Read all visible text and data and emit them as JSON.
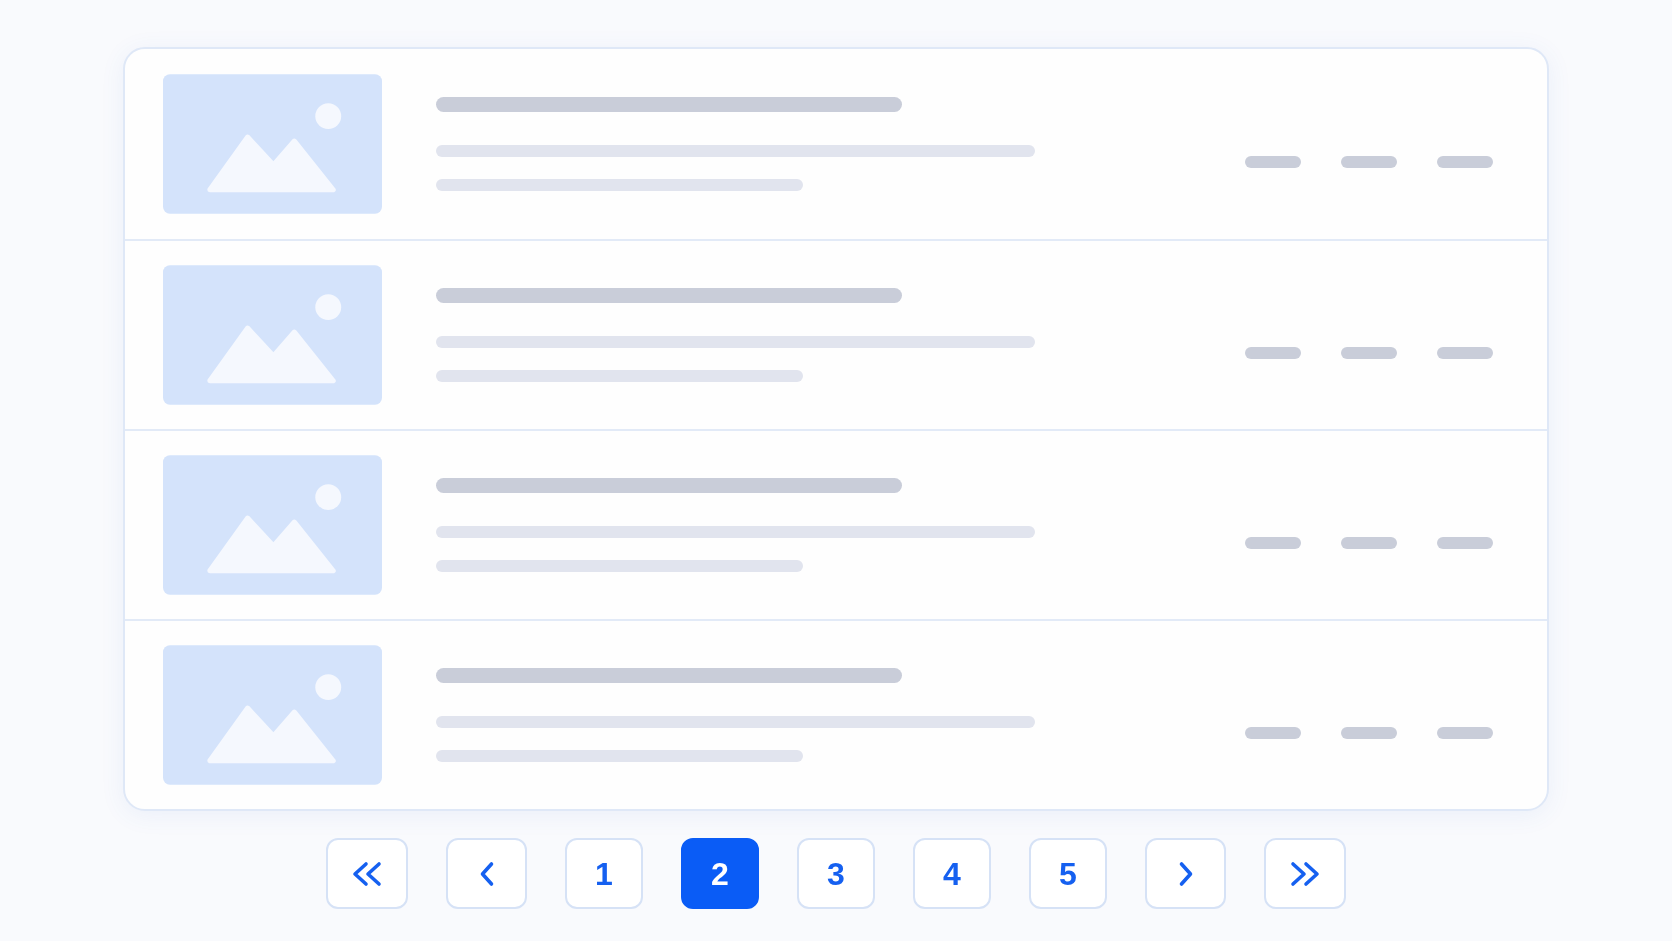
{
  "list": {
    "rows": [
      {
        "kind": "skeleton"
      },
      {
        "kind": "skeleton"
      },
      {
        "kind": "skeleton"
      },
      {
        "kind": "skeleton"
      }
    ]
  },
  "pagination": {
    "buttons": [
      {
        "kind": "first"
      },
      {
        "kind": "previous"
      },
      {
        "kind": "page",
        "label": "1",
        "selected": false
      },
      {
        "kind": "page",
        "label": "2",
        "selected": true
      },
      {
        "kind": "page",
        "label": "3",
        "selected": false
      },
      {
        "kind": "page",
        "label": "4",
        "selected": false
      },
      {
        "kind": "page",
        "label": "5",
        "selected": false
      },
      {
        "kind": "next"
      },
      {
        "kind": "last"
      }
    ]
  }
}
